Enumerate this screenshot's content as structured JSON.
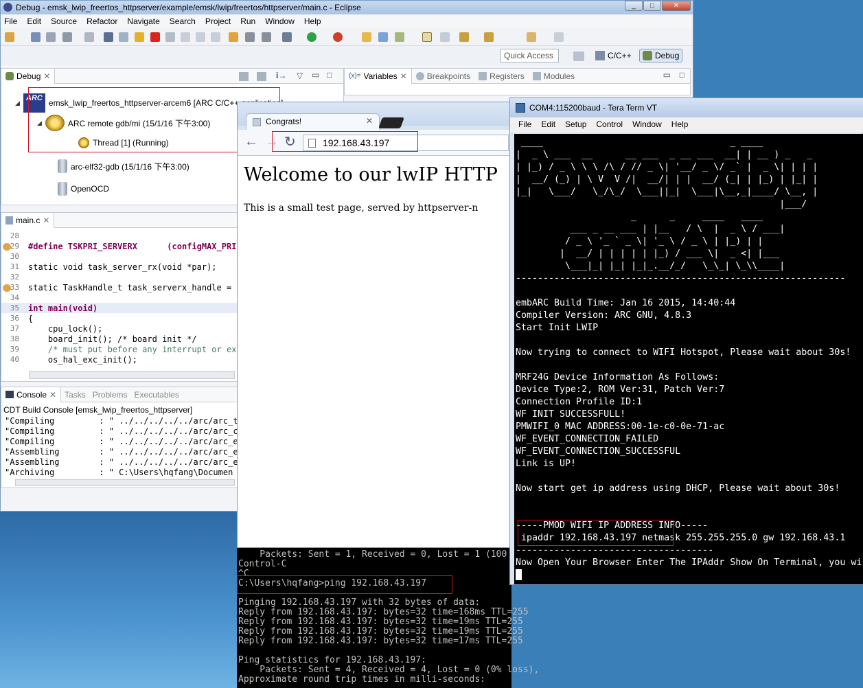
{
  "eclipse": {
    "title": "Debug - emsk_lwip_freertos_httpserver/example/emsk/lwip/freertos/httpserver/main.c - Eclipse",
    "menu": [
      "File",
      "Edit",
      "Source",
      "Refactor",
      "Navigate",
      "Search",
      "Project",
      "Run",
      "Window",
      "Help"
    ],
    "quick_access": "Quick Access",
    "perspectives": [
      "C/C++",
      "Debug"
    ],
    "debug_view": {
      "tab": "Debug",
      "tree": [
        "emsk_lwip_freertos_httpserver-arcem6 [ARC C/C++ application]",
        "ARC remote gdb/mi (15/1/16 下午3:00)",
        "Thread [1] (Running)",
        "arc-elf32-gdb (15/1/16 下午3:00)",
        "OpenOCD"
      ]
    },
    "var_view_tabs": [
      "Variables",
      "Breakpoints",
      "Registers",
      "Modules"
    ],
    "editor": {
      "tab": "main.c",
      "lines": [
        {
          "n": "28",
          "t": ""
        },
        {
          "n": "29",
          "t": "#define TSKPRI_SERVERX      (configMAX_PRIO"
        },
        {
          "n": "30",
          "t": ""
        },
        {
          "n": "31",
          "t": "static void task_server_rx(void *par);"
        },
        {
          "n": "32",
          "t": ""
        },
        {
          "n": "33",
          "t": "static TaskHandle_t task_serverx_handle = N"
        },
        {
          "n": "34",
          "t": ""
        },
        {
          "n": "35",
          "t": "int main(void)"
        },
        {
          "n": "36",
          "t": "{"
        },
        {
          "n": "37",
          "t": "    cpu_lock();"
        },
        {
          "n": "38",
          "t": "    board_init(); /* board init */"
        },
        {
          "n": "39",
          "t": "    /* must put before any interrupt or exc"
        },
        {
          "n": "40",
          "t": "    os_hal_exc_init();"
        }
      ]
    },
    "console": {
      "tabs": [
        "Console",
        "Tasks",
        "Problems",
        "Executables"
      ],
      "header": "CDT Build Console [emsk_lwip_freertos_httpserver]",
      "lines": [
        "\"Compiling         : \" ../../../../../arc/arc_t",
        "\"Compiling         : \" ../../../../../arc/arc_c",
        "\"Compiling         : \" ../../../../../arc/arc_e",
        "\"Assembling        : \" ../../../../../arc/arc_e",
        "\"Assembling        : \" ../../../../../arc/arc_e",
        "\"Archiving         : \" C:\\Users\\hqfang\\Documen"
      ]
    }
  },
  "browser": {
    "tab_title": "Congrats!",
    "url": "192.168.43.197",
    "heading": "Welcome to our lwIP HTTP",
    "body": "This is a small test page, served by httpserver-n"
  },
  "cmd": {
    "lines": [
      "    Packets: Sent = 1, Received = 0, Lost = 1 (100",
      "Control-C",
      "^C",
      "C:\\Users\\hqfang>ping 192.168.43.197",
      "",
      "Pinging 192.168.43.197 with 32 bytes of data:",
      "Reply from 192.168.43.197: bytes=32 time=168ms TTL=255",
      "Reply from 192.168.43.197: bytes=32 time=19ms TTL=255",
      "Reply from 192.168.43.197: bytes=32 time=19ms TTL=255",
      "Reply from 192.168.43.197: bytes=32 time=17ms TTL=255",
      "",
      "Ping statistics for 192.168.43.197:",
      "    Packets: Sent = 4, Received = 4, Lost = 0 (0% loss),",
      "Approximate round trip times in milli-seconds:"
    ]
  },
  "tera": {
    "title": "COM4:115200baud - Tera Term VT",
    "menu": [
      "File",
      "Edit",
      "Setup",
      "Control",
      "Window",
      "Help"
    ],
    "banner": [
      " ____                                  _ ____",
      "|  _ \\ ___  __      __ ___  _ __ ___  __| | __ ) _   _",
      "| |_) / _ \\ \\ \\ /\\ / // _ \\| '__/ _ \\/ _` |  _ \\| | | |",
      "|  __/ (_) | \\ V  V /|  __/| | |  __/ (_| | |_) | |_| |",
      "|_|   \\___/   \\_/\\_/  \\___||_|  \\___|\\__,_|____/ \\__, |",
      "                                                |___/",
      "                     _      _     ____   ____",
      "          ___ _ __ ___ | |__   / \\  |  _ \\ / ___|",
      "         / _ \\ '_ ` _ \\| '_ \\ / _ \\ | |_) | |",
      "        |  __/ | | | | | |_) / ___ \\|  _ <| |___",
      "         \\___|_| |_| |_|_.__/_/   \\_\\_| \\_\\\\____|"
    ],
    "separator": "------------------------------------------------------------",
    "lines": [
      "embARC Build Time: Jan 16 2015, 14:40:44",
      "Compiler Version: ARC GNU, 4.8.3",
      "Start Init LWIP",
      "",
      "Now trying to connect to WIFI Hotspot, Please wait about 30s!",
      "",
      "MRF24G Device Information As Follows:",
      "Device Type:2, ROM Ver:31, Patch Ver:7",
      "Connection Profile ID:1",
      "WF INIT SUCCESSFULL!",
      "PMWIFI_0 MAC ADDRESS:00-1e-c0-0e-71-ac",
      "WF_EVENT_CONNECTION_FAILED",
      "WF_EVENT_CONNECTION_SUCCESSFUL",
      "Link is UP!",
      "",
      "Now start get ip address using DHCP, Please wait about 30s!",
      "",
      "",
      "-----PMOD WIFI IP ADDRESS INFO-----",
      " ipaddr 192.168.43.197 netmask 255.255.255.0 gw 192.168.43.1",
      "------------------------------------",
      "Now Open Your Browser Enter The IPAddr Show On Terminal, you wi"
    ]
  },
  "colors": {
    "highlight_box": "#d0142a",
    "terminal_bg": "#000000",
    "terminal_fg": "#ffffff"
  }
}
